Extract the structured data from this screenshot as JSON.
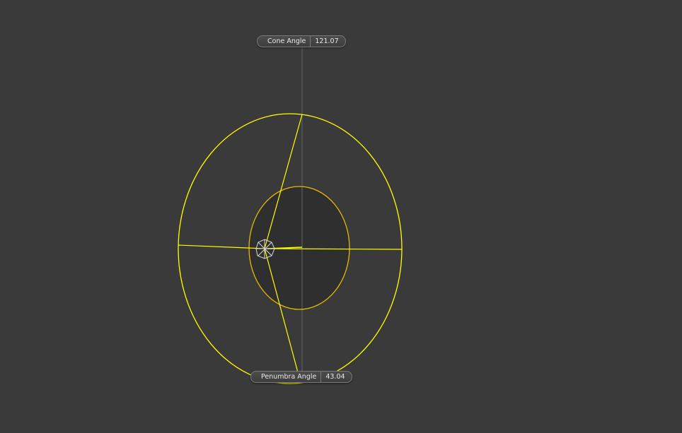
{
  "viewport": {
    "background": "#3a3a3a",
    "accent_color": "#ffff00",
    "inner_color": "#e8b800"
  },
  "handles": {
    "cone": {
      "label": "Cone Angle",
      "value": "121.07"
    },
    "penumbra": {
      "label": "Penumbra Angle",
      "value": "43.04"
    }
  },
  "light": {
    "icon": "spotlight-icon"
  }
}
